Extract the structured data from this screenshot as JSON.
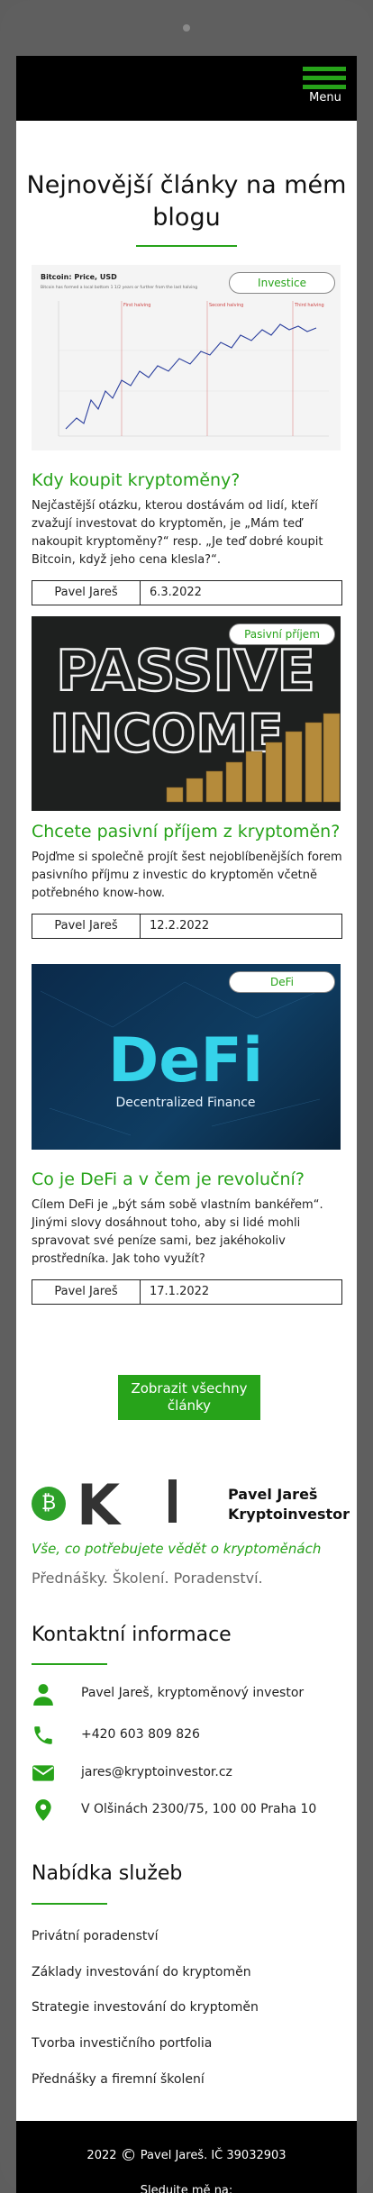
{
  "header": {
    "menu_label": "Menu"
  },
  "blog": {
    "title": "Nejnovější články na mém blogu",
    "articles": [
      {
        "badge": "Investice",
        "title": "Kdy koupit kryptoměny?",
        "text": "Nejčastější otázku, kterou dostávám od lidí, kteří zvažují investovat do kryptoměn, je „Mám teď nakoupit kryptoměny?“ resp. „Je teď dobré koupit Bitcoin, když jeho cena klesla?“.",
        "author": "Pavel Jareš",
        "date": "6.3.2022",
        "image": {
          "chart_title": "Bitcoin: Price, USD",
          "chart_sub": "Bitcoin has formed a local bottom 1 1/2 years or further from the last halving",
          "halvings": [
            "First halving",
            "Second halving",
            "Third halving"
          ]
        }
      },
      {
        "badge": "Pasivní příjem",
        "title": "Chcete pasivní příjem z kryptoměn?",
        "text": "Pojďme si společně projít šest nejoblíbenějších forem pasivního příjmu z investic do kryptoměn včetně potřebného know-how.",
        "author": "Pavel Jareš",
        "date": "12.2.2022",
        "image": {
          "line1": "PASSIVE",
          "line2": "INCOME"
        }
      },
      {
        "badge": "DeFi",
        "title": "Co je DeFi a v čem je revoluční?",
        "text": "Cílem DeFi je „být sám sobě vlastním bankéřem“. Jinými slovy dosáhnout toho, aby si lidé mohli spravovat své peníze sami, bez jakéhokoliv prostředníka. Jak toho využít?",
        "author": "Pavel Jareš",
        "date": "17.1.2022",
        "image": {
          "big": "DeFi",
          "small": "Decentralized Finance"
        }
      }
    ],
    "show_all": "Zobrazit všechny články"
  },
  "brand": {
    "logo_letters": "K",
    "name_line1": "Pavel Jareš",
    "name_line2": "Kryptoinvestor",
    "tagline": "Vše, co potřebujete vědět o kryptoměnách",
    "subtag": "Přednášky. Školení. Poradenství."
  },
  "contact": {
    "title": "Kontaktní informace",
    "person": "Pavel Jareš, kryptoměnový investor",
    "phone": "+420 603 809 826",
    "email": "jares@kryptoinvestor.cz",
    "address": "V Olšinách 2300/75, 100 00 Praha 10"
  },
  "services": {
    "title": "Nabídka služeb",
    "items": [
      "Privátní poradenství",
      "Základy investování do kryptoměn",
      "Strategie investování do kryptoměn",
      "Tvorba investičního portfolia",
      "Přednášky a firemní školení"
    ]
  },
  "footer": {
    "year": "2022",
    "copyright": "Pavel Jareš. IČ 39032903",
    "follow": "Sledujte mě na:"
  },
  "colors": {
    "accent": "#27a31a",
    "dark": "#000000"
  }
}
